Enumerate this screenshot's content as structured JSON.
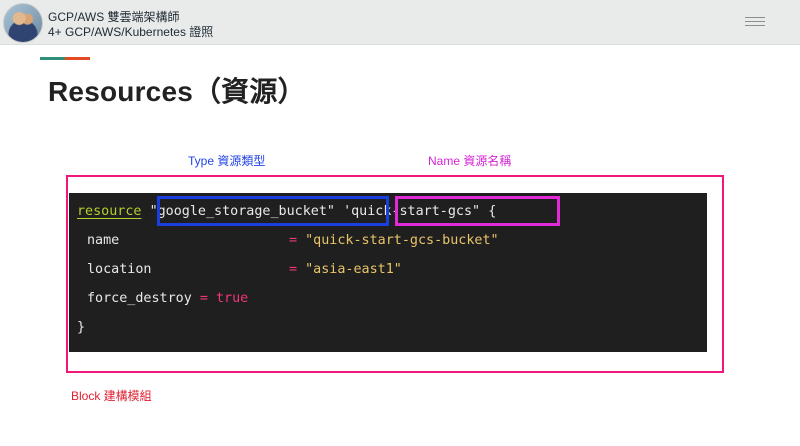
{
  "header": {
    "line1": "GCP/AWS 雙雲端架構師",
    "line2": "4+ GCP/AWS/Kubernetes 證照",
    "menu_icon": "hamburger-menu-icon"
  },
  "colors": {
    "accent_green": "#2f8f78",
    "accent_orange": "#e24b22",
    "outer_box": "#f0187a",
    "type_box": "#1a3fe0",
    "name_box": "#e22ad8",
    "code_bg": "#1f1f1f"
  },
  "slide": {
    "title": "Resources（資源）",
    "annotations": {
      "type": "Type 資源類型",
      "name": "Name 資源名稱",
      "block": "Block 建構模組"
    }
  },
  "code": {
    "keyword": "resource",
    "type_string": "\"google_storage_bucket\"",
    "name_string": "'quick-start-gcs\"",
    "open_brace": "{",
    "close_brace": "}",
    "attributes": [
      {
        "key": "name",
        "value": "\"quick-start-gcs-bucket\""
      },
      {
        "key": "location",
        "value": "\"asia-east1\""
      },
      {
        "key": "force_destroy",
        "value": "true"
      }
    ],
    "equals": "="
  }
}
